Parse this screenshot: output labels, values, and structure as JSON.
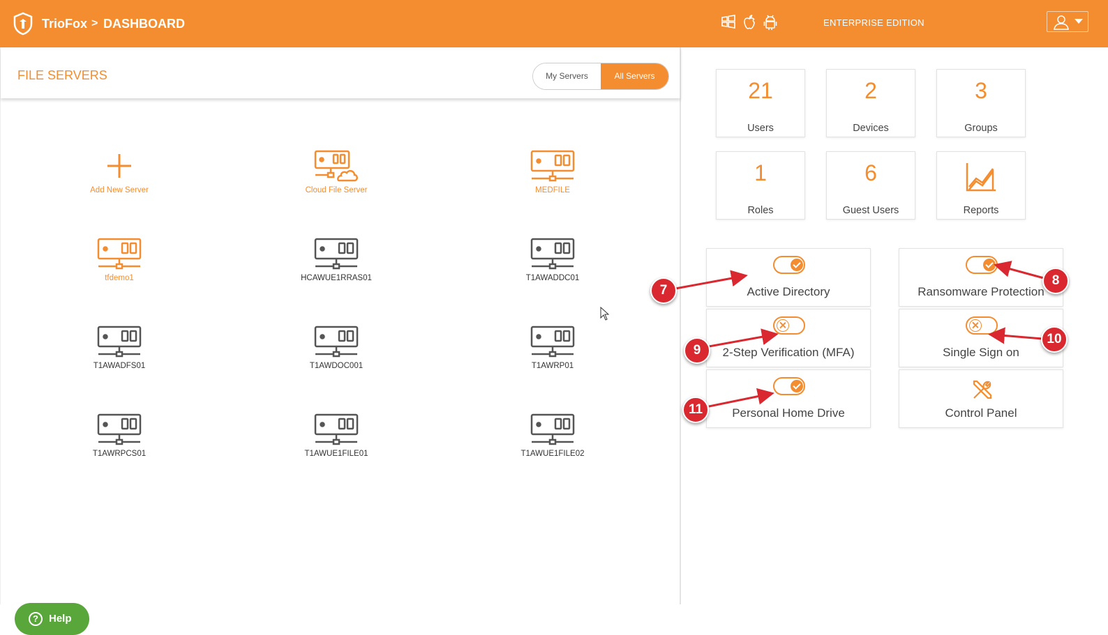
{
  "header": {
    "brand": "TrioFox",
    "crumb_sep": ">",
    "crumb": "DASHBOARD",
    "os_icons": [
      "windows-icon",
      "apple-icon",
      "android-icon"
    ],
    "edition": "ENTERPRISE EDITION",
    "user_icon": "user-icon"
  },
  "file_servers": {
    "title": "FILE SERVERS",
    "tabs": [
      {
        "label": "My Servers",
        "active": false
      },
      {
        "label": "All Servers",
        "active": true
      }
    ],
    "servers": [
      {
        "label": "Add New Server",
        "icon": "plus-icon",
        "accent": true
      },
      {
        "label": "Cloud File Server",
        "icon": "cloud-server-icon",
        "accent": true
      },
      {
        "label": "MEDFILE",
        "icon": "server-icon",
        "accent": true
      },
      {
        "label": "tfdemo1",
        "icon": "server-icon",
        "accent": true
      },
      {
        "label": "HCAWUE1RRAS01",
        "icon": "server-icon",
        "accent": false
      },
      {
        "label": "T1AWADDC01",
        "icon": "server-icon",
        "accent": false
      },
      {
        "label": "T1AWADFS01",
        "icon": "server-icon",
        "accent": false
      },
      {
        "label": "T1AWDOC001",
        "icon": "server-icon",
        "accent": false
      },
      {
        "label": "T1AWRP01",
        "icon": "server-icon",
        "accent": false
      },
      {
        "label": "T1AWRPCS01",
        "icon": "server-icon",
        "accent": false
      },
      {
        "label": "T1AWUE1FILE01",
        "icon": "server-icon",
        "accent": false
      },
      {
        "label": "T1AWUE1FILE02",
        "icon": "server-icon",
        "accent": false
      }
    ]
  },
  "help": {
    "label": "Help"
  },
  "stats": [
    {
      "value": "21",
      "label": "Users"
    },
    {
      "value": "2",
      "label": "Devices"
    },
    {
      "value": "3",
      "label": "Groups"
    },
    {
      "value": "1",
      "label": "Roles"
    },
    {
      "value": "6",
      "label": "Guest Users"
    },
    {
      "value": "",
      "label": "Reports",
      "icon": "chart-icon"
    }
  ],
  "features": [
    {
      "label": "Active Directory",
      "enabled": true
    },
    {
      "label": "Ransomware Protection",
      "enabled": true
    },
    {
      "label": "2-Step Verification (MFA)",
      "enabled": false
    },
    {
      "label": "Single Sign on",
      "enabled": false
    },
    {
      "label": "Personal Home Drive",
      "enabled": true
    },
    {
      "label": "Control Panel",
      "icon": "tools-icon"
    }
  ],
  "callouts": [
    "7",
    "8",
    "9",
    "10",
    "11"
  ],
  "colors": {
    "accent": "#f48d2f",
    "help": "#59a63a",
    "callout": "#d9282f",
    "icon_gray": "#555555"
  }
}
